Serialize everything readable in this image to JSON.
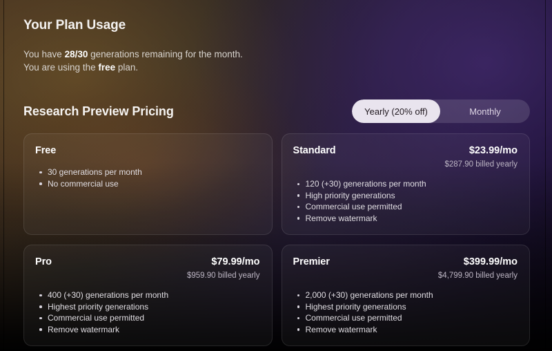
{
  "usage": {
    "title": "Your Plan Usage",
    "line1_prefix": "You have ",
    "line1_count": "28/30",
    "line1_suffix": " generations remaining for the month.",
    "line2_prefix": "You are using the ",
    "line2_plan": "free",
    "line2_suffix": " plan."
  },
  "pricing": {
    "title": "Research Preview Pricing",
    "billing_toggle": {
      "yearly_label": "Yearly (20% off)",
      "monthly_label": "Monthly",
      "selected": "Yearly (20% off)"
    },
    "plans": [
      {
        "name": "Free",
        "price": "",
        "billed": "",
        "features": [
          "30 generations per month",
          "No commercial use"
        ]
      },
      {
        "name": "Standard",
        "price": "$23.99/mo",
        "billed": "$287.90 billed yearly",
        "features": [
          "120 (+30) generations per month",
          "High priority generations",
          "Commercial use permitted",
          "Remove watermark"
        ]
      },
      {
        "name": "Pro",
        "price": "$79.99/mo",
        "billed": "$959.90 billed yearly",
        "features": [
          "400 (+30) generations per month",
          "Highest priority generations",
          "Commercial use permitted",
          "Remove watermark"
        ]
      },
      {
        "name": "Premier",
        "price": "$399.99/mo",
        "billed": "$4,799.90 billed yearly",
        "features": [
          "2,000 (+30) generations per month",
          "Highest priority generations",
          "Commercial use permitted",
          "Remove watermark"
        ]
      }
    ]
  },
  "colors": {
    "toggle_active_bg": "#e9e4ee",
    "toggle_active_text": "#20181f",
    "card_border": "rgba(255,255,255,0.10)",
    "text_primary": "#ffffff",
    "text_muted": "#bdb6c4"
  }
}
